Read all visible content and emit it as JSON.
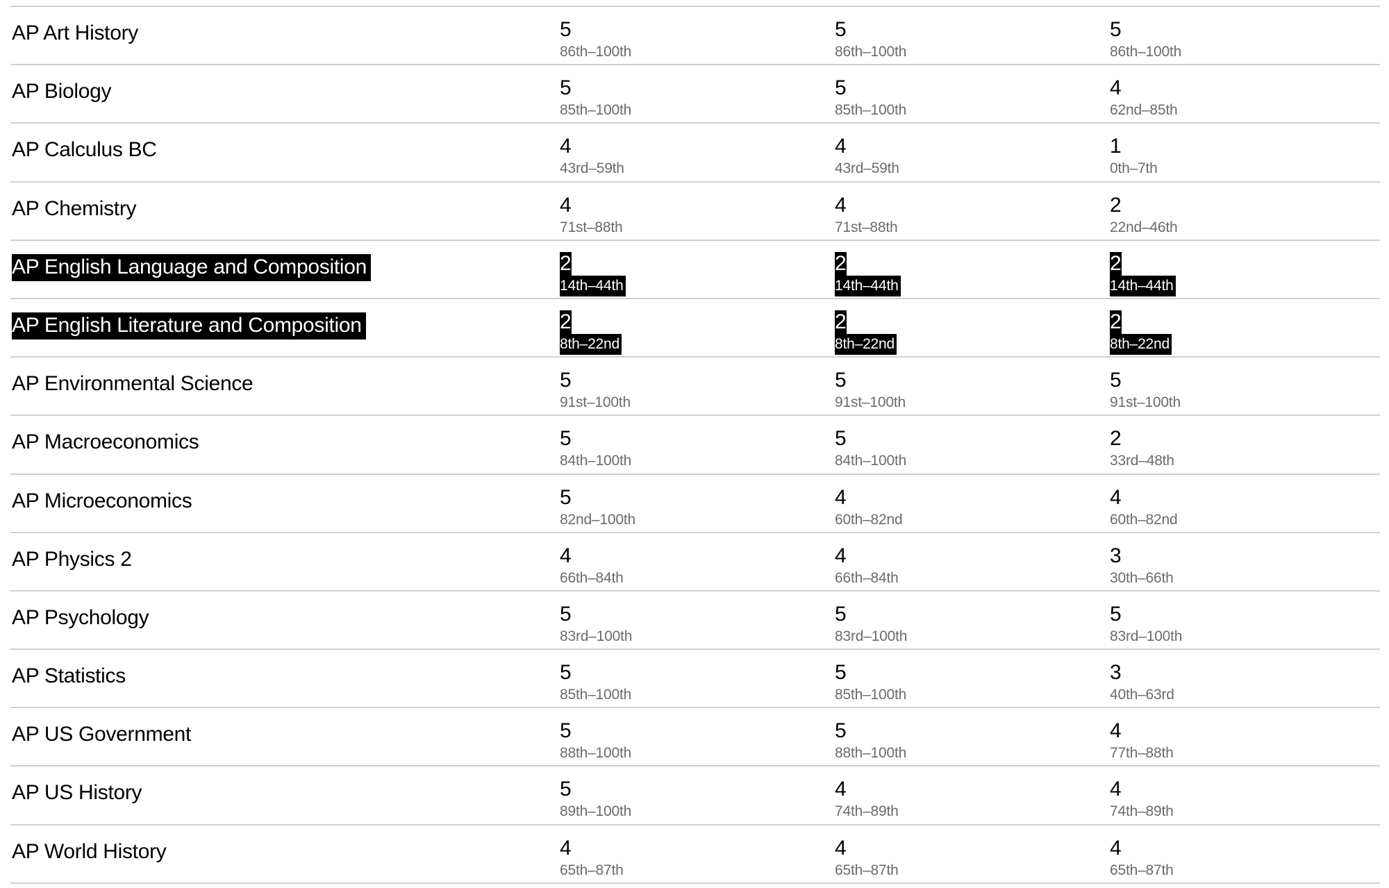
{
  "table": {
    "rows": [
      {
        "exam": "AP Art History",
        "selected": false,
        "results": [
          {
            "score": "5",
            "percentile": "86th–100th"
          },
          {
            "score": "5",
            "percentile": "86th–100th"
          },
          {
            "score": "5",
            "percentile": "86th–100th"
          }
        ]
      },
      {
        "exam": "AP Biology",
        "selected": false,
        "results": [
          {
            "score": "5",
            "percentile": "85th–100th"
          },
          {
            "score": "5",
            "percentile": "85th–100th"
          },
          {
            "score": "4",
            "percentile": "62nd–85th"
          }
        ]
      },
      {
        "exam": "AP Calculus BC",
        "selected": false,
        "results": [
          {
            "score": "4",
            "percentile": "43rd–59th"
          },
          {
            "score": "4",
            "percentile": "43rd–59th"
          },
          {
            "score": "1",
            "percentile": "0th–7th"
          }
        ]
      },
      {
        "exam": "AP Chemistry",
        "selected": false,
        "results": [
          {
            "score": "4",
            "percentile": "71st–88th"
          },
          {
            "score": "4",
            "percentile": "71st–88th"
          },
          {
            "score": "2",
            "percentile": "22nd–46th"
          }
        ]
      },
      {
        "exam": "AP English Language and Composition",
        "selected": true,
        "results": [
          {
            "score": "2",
            "percentile": "14th–44th"
          },
          {
            "score": "2",
            "percentile": "14th–44th"
          },
          {
            "score": "2",
            "percentile": "14th–44th"
          }
        ]
      },
      {
        "exam": "AP English Literature and Composition",
        "selected": true,
        "results": [
          {
            "score": "2",
            "percentile": "8th–22nd"
          },
          {
            "score": "2",
            "percentile": "8th–22nd"
          },
          {
            "score": "2",
            "percentile": "8th–22nd"
          }
        ]
      },
      {
        "exam": "AP Environmental Science",
        "selected": false,
        "results": [
          {
            "score": "5",
            "percentile": "91st–100th"
          },
          {
            "score": "5",
            "percentile": "91st–100th"
          },
          {
            "score": "5",
            "percentile": "91st–100th"
          }
        ]
      },
      {
        "exam": "AP Macroeconomics",
        "selected": false,
        "results": [
          {
            "score": "5",
            "percentile": "84th–100th"
          },
          {
            "score": "5",
            "percentile": "84th–100th"
          },
          {
            "score": "2",
            "percentile": "33rd–48th"
          }
        ]
      },
      {
        "exam": "AP Microeconomics",
        "selected": false,
        "results": [
          {
            "score": "5",
            "percentile": "82nd–100th"
          },
          {
            "score": "4",
            "percentile": "60th–82nd"
          },
          {
            "score": "4",
            "percentile": "60th–82nd"
          }
        ]
      },
      {
        "exam": "AP Physics 2",
        "selected": false,
        "results": [
          {
            "score": "4",
            "percentile": "66th–84th"
          },
          {
            "score": "4",
            "percentile": "66th–84th"
          },
          {
            "score": "3",
            "percentile": "30th–66th"
          }
        ]
      },
      {
        "exam": "AP Psychology",
        "selected": false,
        "results": [
          {
            "score": "5",
            "percentile": "83rd–100th"
          },
          {
            "score": "5",
            "percentile": "83rd–100th"
          },
          {
            "score": "5",
            "percentile": "83rd–100th"
          }
        ]
      },
      {
        "exam": "AP Statistics",
        "selected": false,
        "results": [
          {
            "score": "5",
            "percentile": "85th–100th"
          },
          {
            "score": "5",
            "percentile": "85th–100th"
          },
          {
            "score": "3",
            "percentile": "40th–63rd"
          }
        ]
      },
      {
        "exam": "AP US Government",
        "selected": false,
        "results": [
          {
            "score": "5",
            "percentile": "88th–100th"
          },
          {
            "score": "5",
            "percentile": "88th–100th"
          },
          {
            "score": "4",
            "percentile": "77th–88th"
          }
        ]
      },
      {
        "exam": "AP US History",
        "selected": false,
        "results": [
          {
            "score": "5",
            "percentile": "89th–100th"
          },
          {
            "score": "4",
            "percentile": "74th–89th"
          },
          {
            "score": "4",
            "percentile": "74th–89th"
          }
        ]
      },
      {
        "exam": "AP World History",
        "selected": false,
        "results": [
          {
            "score": "4",
            "percentile": "65th–87th"
          },
          {
            "score": "4",
            "percentile": "65th–87th"
          },
          {
            "score": "4",
            "percentile": "65th–87th"
          }
        ]
      }
    ]
  },
  "colors": {
    "selection_bg": "#000000",
    "selection_fg": "#ffffff",
    "percentile_text": "#6b6b6b",
    "divider": "#d0d0d0"
  }
}
